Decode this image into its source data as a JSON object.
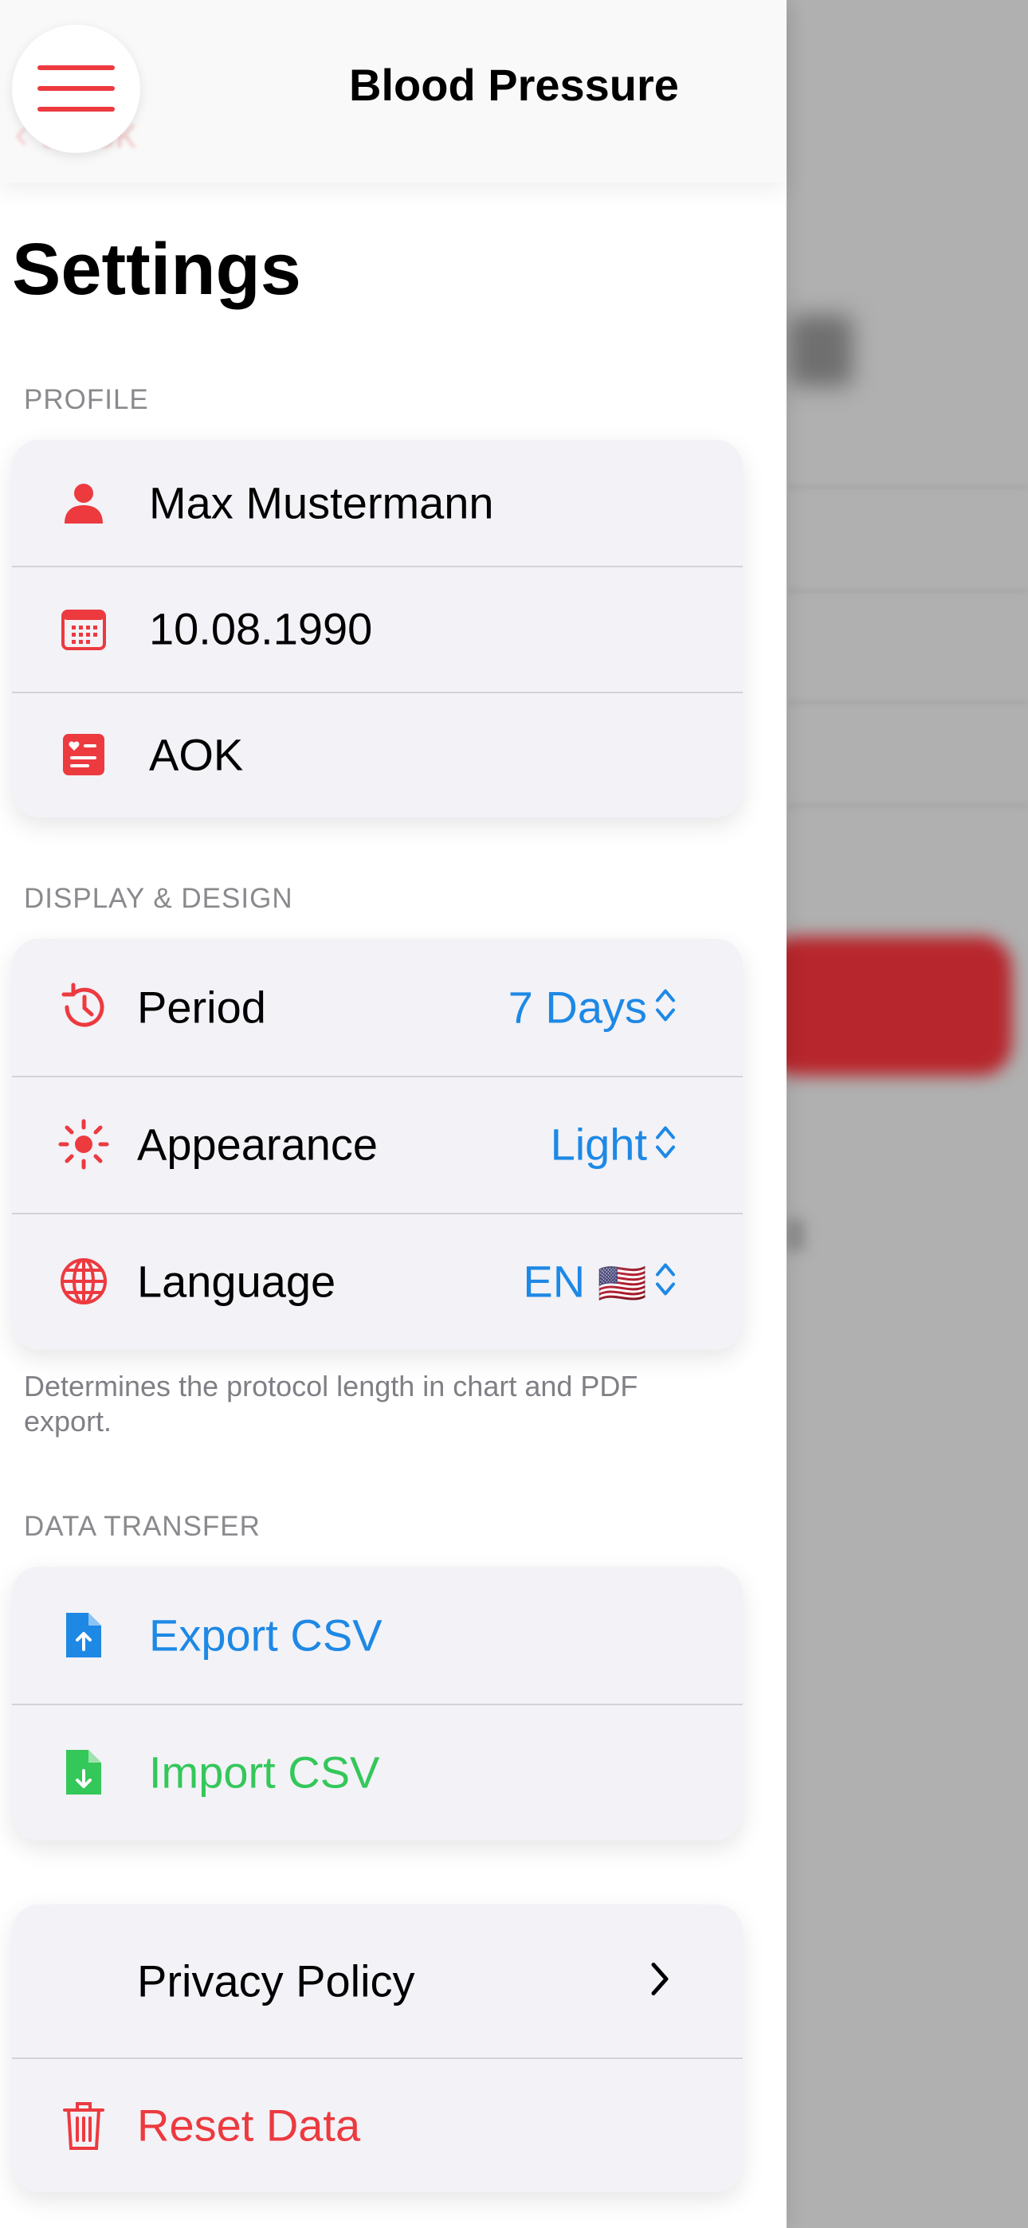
{
  "nav": {
    "title": "Blood Pressure",
    "back_label": "Back"
  },
  "page_title": "Settings",
  "profile": {
    "header": "PROFILE",
    "name": "Max Mustermann",
    "birthdate": "10.08.1990",
    "insurance": "AOK"
  },
  "display": {
    "header": "DISPLAY & DESIGN",
    "period_label": "Period",
    "period_value": "7 Days",
    "appearance_label": "Appearance",
    "appearance_value": "Light",
    "language_label": "Language",
    "language_value": "EN",
    "language_flag": "🇺🇸",
    "footnote": "Determines the protocol length in chart and PDF export."
  },
  "transfer": {
    "header": "DATA TRANSFER",
    "export_label": "Export CSV",
    "import_label": "Import CSV"
  },
  "misc": {
    "privacy_label": "Privacy Policy",
    "reset_label": "Reset Data"
  },
  "colors": {
    "accent_red": "#ec3a3f",
    "value_blue": "#1e88e5",
    "import_green": "#34c759"
  },
  "icons": {
    "menu": "hamburger-menu-icon",
    "profile": "person-icon",
    "birthdate": "calendar-icon",
    "insurance": "health-card-icon",
    "period": "history-clock-icon",
    "appearance": "sun-icon",
    "language": "globe-icon",
    "export": "document-upload-icon",
    "import": "document-download-icon",
    "privacy": "chevron-right-icon",
    "reset": "trash-icon"
  }
}
